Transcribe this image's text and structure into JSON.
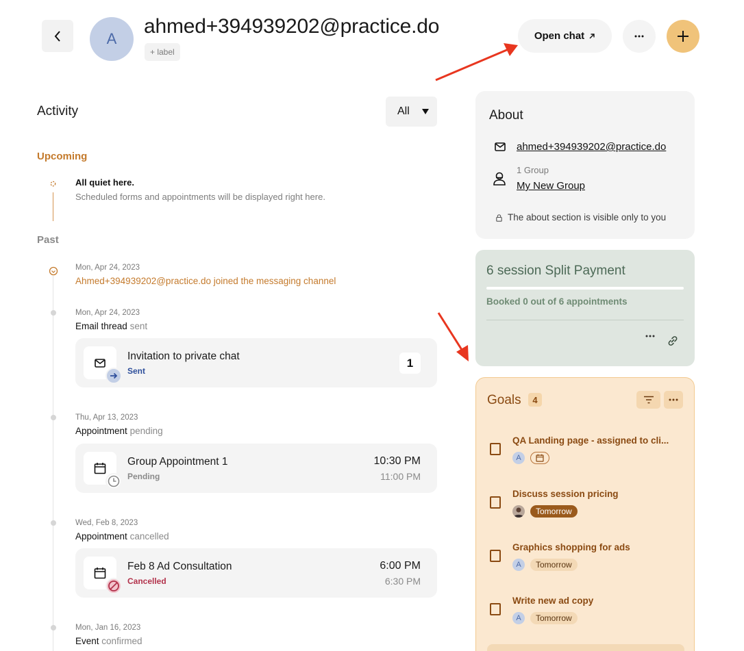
{
  "header": {
    "avatar_initial": "A",
    "contact_name": "ahmed+394939202@practice.do",
    "label_chip": "+ label",
    "open_chat_label": "Open chat"
  },
  "activity": {
    "title": "Activity",
    "filter_value": "All",
    "upcoming_label": "Upcoming",
    "quiet_title": "All quiet here.",
    "quiet_subtitle": "Scheduled forms and appointments will be displayed right here.",
    "past_label": "Past",
    "events": [
      {
        "date": "Mon, Apr 24, 2023",
        "text": "Ahmed+394939202@practice.do joined the messaging channel"
      },
      {
        "date": "Mon, Apr 24, 2023",
        "type": "Email thread",
        "state": "sent",
        "card": {
          "title": "Invitation to private chat",
          "status": "Sent",
          "count": "1"
        }
      },
      {
        "date": "Thu, Apr 13, 2023",
        "type": "Appointment",
        "state": "pending",
        "card": {
          "title": "Group Appointment 1",
          "status": "Pending",
          "start": "10:30 PM",
          "end": "11:00 PM"
        }
      },
      {
        "date": "Wed, Feb 8, 2023",
        "type": "Appointment",
        "state": "cancelled",
        "card": {
          "title": "Feb 8 Ad Consultation",
          "status": "Cancelled",
          "start": "6:00 PM",
          "end": "6:30 PM"
        }
      },
      {
        "date": "Mon, Jan 16, 2023",
        "type": "Event",
        "state": "confirmed"
      }
    ]
  },
  "about": {
    "title": "About",
    "email": "ahmed+394939202@practice.do",
    "group_count": "1 Group",
    "group_name": "My New Group",
    "visibility_note": "The about section is visible only to you"
  },
  "package": {
    "title": "6 session Split Payment",
    "booked_text": "Booked 0 out of 6 appointments",
    "progress": 0
  },
  "goals": {
    "title": "Goals",
    "count": "4",
    "items": [
      {
        "title": "QA Landing page - assigned to cli...",
        "assignee": "A",
        "due": ""
      },
      {
        "title": "Discuss session pricing",
        "assignee": "",
        "due": "Tomorrow"
      },
      {
        "title": "Graphics shopping for ads",
        "assignee": "A",
        "due": "Tomorrow"
      },
      {
        "title": "Write new ad copy",
        "assignee": "A",
        "due": "Tomorrow"
      }
    ]
  },
  "colors": {
    "accent_orange": "#c47a2c",
    "add_button": "#f0c37a",
    "goals_bg": "#fbe8d0",
    "package_bg": "#dfe6e0",
    "cancelled_red": "#b2324b",
    "sent_blue": "#2e4f9b",
    "annotation_red": "#e8361f"
  },
  "icons": [
    "chevron-left-icon",
    "arrow-up-right-icon",
    "ellipsis-icon",
    "plus-icon",
    "dropdown-caret-icon",
    "mail-icon",
    "person-group-icon",
    "lock-icon",
    "calendar-icon",
    "clock-icon",
    "cancel-icon",
    "arrow-right-icon",
    "filter-icon",
    "link-icon"
  ]
}
